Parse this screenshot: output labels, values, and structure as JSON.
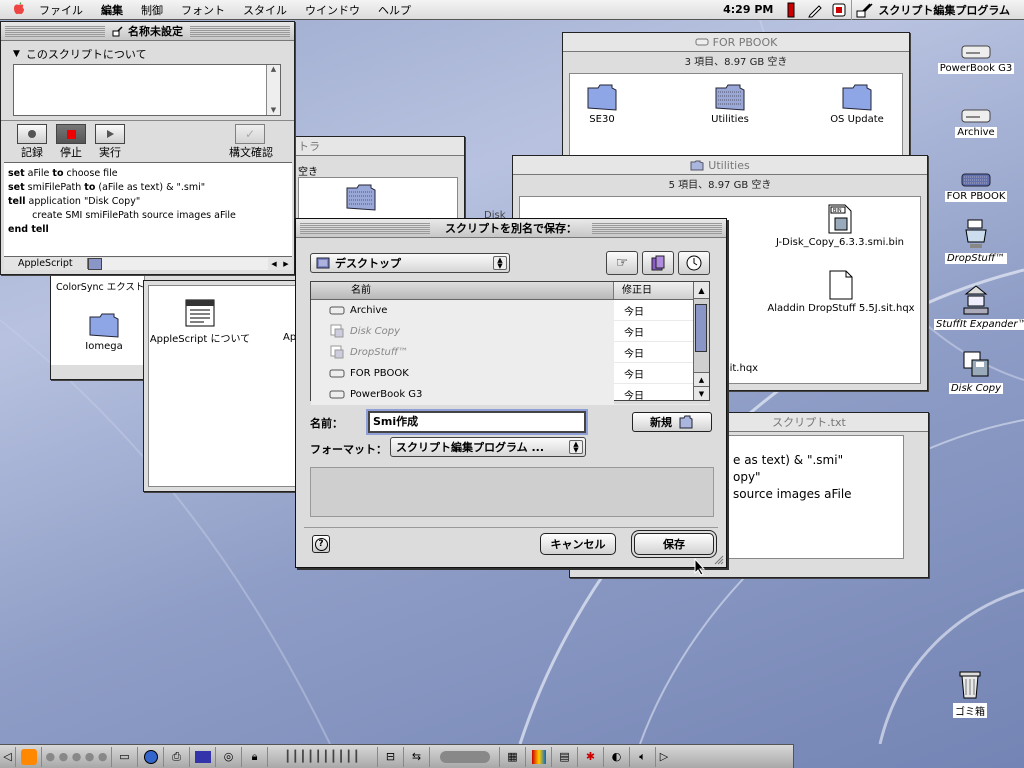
{
  "menubar": {
    "items": [
      "ファイル",
      "編集",
      "制御",
      "フォント",
      "スタイル",
      "ウインドウ",
      "ヘルプ"
    ],
    "active_item": "編集",
    "clock": "4:29 PM",
    "app_name": "スクリプト編集プログラム"
  },
  "script_editor": {
    "title": "名称未設定",
    "description_header": "このスクリプトについて",
    "buttons": {
      "record": "記録",
      "stop": "停止",
      "run": "実行",
      "check_syntax": "構文確認"
    },
    "code_lines": [
      {
        "kw": "set",
        "rest": " aFile ",
        "kw2": "to",
        "rest2": " choose file"
      },
      {
        "kw": "set",
        "rest": " smiFilePath ",
        "kw2": "to",
        "rest2": " (aFile as text) & \".smi\""
      },
      {
        "kw": "tell",
        "rest": " application \"Disk Copy\"",
        "kw2": "",
        "rest2": ""
      },
      {
        "kw": "",
        "rest": "        create SMI smiFilePath source images aFile",
        "kw2": "",
        "rest2": ""
      },
      {
        "kw": "end tell",
        "rest": "",
        "kw2": "",
        "rest2": ""
      }
    ],
    "language": "AppleScript"
  },
  "finder_pbook": {
    "title": "FOR PBOOK",
    "info": "3 項目、8.97 GB 空き",
    "items": [
      "SE30",
      "Utilities",
      "OS Update"
    ]
  },
  "finder_utilities": {
    "title": "Utilities",
    "info": "5 項目、8.97 GB 空き",
    "items": [
      "J-Disk_Copy_6.3.3.smi.bin",
      "Aladdin DropStuff 5.5J.sit.hqx",
      "5J.sit.hqx"
    ]
  },
  "finder_extra": {
    "title_fragment": "トラ",
    "info_fragment": "空き",
    "disk_fragment": "Disk"
  },
  "finder_applescript": {
    "colorsync_label": "ColorSync エクスト",
    "iomega_label": "Iomega",
    "about_label": "AppleScript について",
    "ap_fragment": "Ap"
  },
  "text_doc": {
    "title_fragment": "スクリプト.txt",
    "lines": [
      "e as text) & \".smi\"",
      "opy\"",
      " source images aFile"
    ]
  },
  "save_dialog": {
    "title": "スクリプトを別名で保存：",
    "location": "デスクトップ",
    "col_name": "名前",
    "col_date": "修正日",
    "files": [
      {
        "name": "Archive",
        "date": "今日",
        "dim": false,
        "icon": "drive"
      },
      {
        "name": "Disk Copy",
        "date": "今日",
        "dim": true,
        "icon": "alias"
      },
      {
        "name": "DropStuff™",
        "date": "今日",
        "dim": true,
        "icon": "alias"
      },
      {
        "name": "FOR PBOOK",
        "date": "今日",
        "dim": false,
        "icon": "drive"
      },
      {
        "name": "PowerBook G3",
        "date": "今日",
        "dim": false,
        "icon": "drive"
      }
    ],
    "name_label": "名前：",
    "name_value": "Smi作成",
    "new_folder": "新規",
    "format_label": "フォーマット：",
    "format_value": "スクリプト編集プログラム ...",
    "cancel": "キャンセル",
    "save": "保存"
  },
  "desktop_icons": [
    "PowerBook G3",
    "Archive",
    "FOR PBOOK",
    "DropStuff™",
    "StuffIt Expander™",
    "Disk Copy",
    "ゴミ箱"
  ]
}
